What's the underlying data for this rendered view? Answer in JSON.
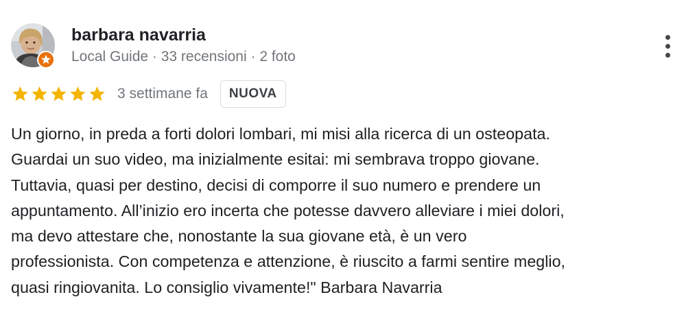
{
  "author": {
    "name": "barbara navarria",
    "meta": "Local Guide · 33 recensioni · 2 foto",
    "avatar_icon": "user-photo",
    "badge_icon": "local-guide-star-icon",
    "badge_color": "#e8710a"
  },
  "menu": {
    "icon": "more-vertical-icon"
  },
  "rating": {
    "stars": 5,
    "max_stars": 5,
    "star_color": "#f4b400",
    "date": "3 settimane fa",
    "badge": "NUOVA"
  },
  "review": {
    "lines": [
      "Un giorno, in preda a forti dolori lombari, mi misi alla ricerca di un osteopata.",
      "Guardai un suo video, ma inizialmente esitai: mi sembrava troppo giovane.",
      "Tuttavia, quasi per destino, decisi di comporre il suo numero e prendere un",
      "appuntamento. All’inizio ero incerta che potesse davvero alleviare i miei dolori,",
      "ma devo attestare che, nonostante la sua giovane età, è un vero",
      "professionista. Con competenza e attenzione, è riuscito a farmi sentire meglio,",
      "quasi ringiovanita. Lo consiglio vivamente!\" Barbara Navarria"
    ]
  }
}
